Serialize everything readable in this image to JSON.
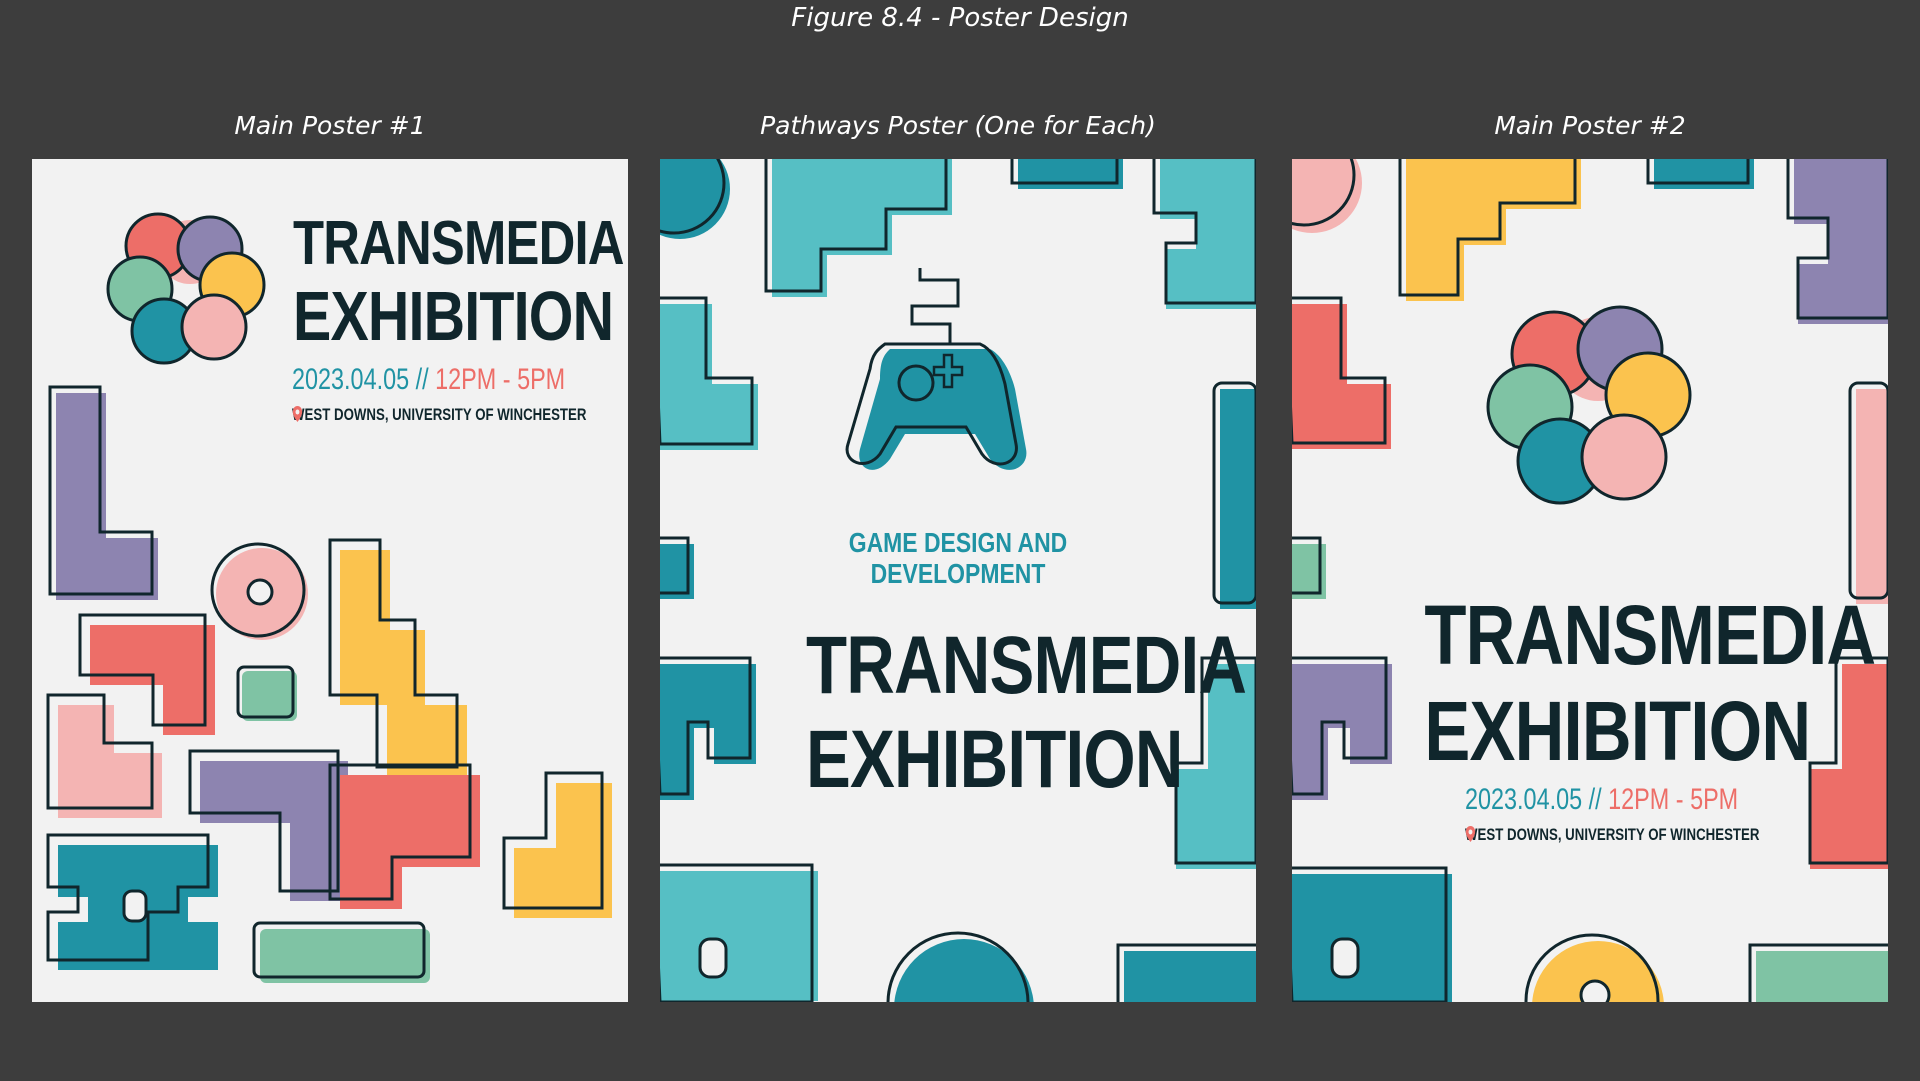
{
  "figure": {
    "title": "Figure 8.4 - Poster Design"
  },
  "columns": [
    {
      "label": "Main Poster #1"
    },
    {
      "label": "Pathways Poster (One for Each)"
    },
    {
      "label": "Main Poster #2"
    }
  ],
  "poster1": {
    "title_line1": "TRANSMEDIA",
    "title_line2": "EXHIBITION",
    "date": "2023.04.05",
    "separator": "//",
    "time": "12PM - 5PM",
    "venue": "WEST DOWNS, UNIVERSITY OF WINCHESTER"
  },
  "poster2": {
    "pathway_line1": "GAME DESIGN AND",
    "pathway_line2": "DEVELOPMENT",
    "title_line1": "TRANSMEDIA",
    "title_line2": "EXHIBITION"
  },
  "poster3": {
    "title_line1": "TRANSMEDIA",
    "title_line2": "EXHIBITION",
    "date": "2023.04.05",
    "separator": "//",
    "time": "12PM - 5PM",
    "venue": "WEST DOWNS, UNIVERSITY OF WINCHESTER"
  },
  "palette": {
    "background": "#3d3d3d",
    "poster_bg": "#f2f2f2",
    "teal": "#2093a4",
    "light_teal": "#56bfc4",
    "purple": "#8d84b0",
    "red": "#ed6e68",
    "pink": "#f4b4b3",
    "yellow": "#fbc34e",
    "green": "#7fc3a4",
    "ink": "#10262c"
  },
  "icons": [
    "flower-logo-icon",
    "location-pin-icon",
    "game-controller-icon"
  ]
}
